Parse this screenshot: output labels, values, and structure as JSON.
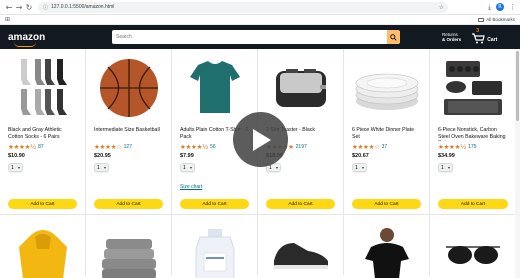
{
  "browser": {
    "url": "127.0.0.1:5500/amazon.html",
    "bookmarks_label": "All Bookmarks",
    "profile_letter": "R"
  },
  "header": {
    "logo": "amazon",
    "search_placeholder": "Search",
    "returns_line1": "Returns",
    "returns_line2": "& Orders",
    "cart_count": "3",
    "cart_label": "Cart"
  },
  "products": [
    {
      "name": "Black and Gray Athletic Cotton Socks - 6 Pairs",
      "stars": "★★★★½",
      "count": "87",
      "price": "$10.90",
      "qty": "1",
      "add": "Add to Cart"
    },
    {
      "name": "Intermediate Size Basketball",
      "stars": "★★★★☆",
      "count": "127",
      "price": "$20.95",
      "qty": "1",
      "add": "Add to Cart"
    },
    {
      "name": "Adults Plain Cotton T-Shirt - 2 Pack",
      "stars": "★★★★½",
      "count": "56",
      "price": "$7.99",
      "qty": "1",
      "add": "Add to Cart",
      "extra": "Size chart"
    },
    {
      "name": "2 Slot Toaster - Black",
      "stars": "★★★★★",
      "count": "2197",
      "price": "$18.99",
      "qty": "1",
      "add": "Add to Cart"
    },
    {
      "name": "6 Piece White Dinner Plate Set",
      "stars": "★★★★☆",
      "count": "37",
      "price": "$20.67",
      "qty": "1",
      "add": "Add to Cart"
    },
    {
      "name": "6-Piece Nonstick, Carbon Steel Oven Bakeware Baking Set",
      "stars": "★★★★½",
      "count": "175",
      "price": "$34.99",
      "qty": "1",
      "add": "Add to Cart"
    }
  ],
  "colors": {
    "header": "#131921",
    "accent": "#ff9900",
    "button": "#ffd814",
    "link": "#007185",
    "stars": "#de7921"
  }
}
